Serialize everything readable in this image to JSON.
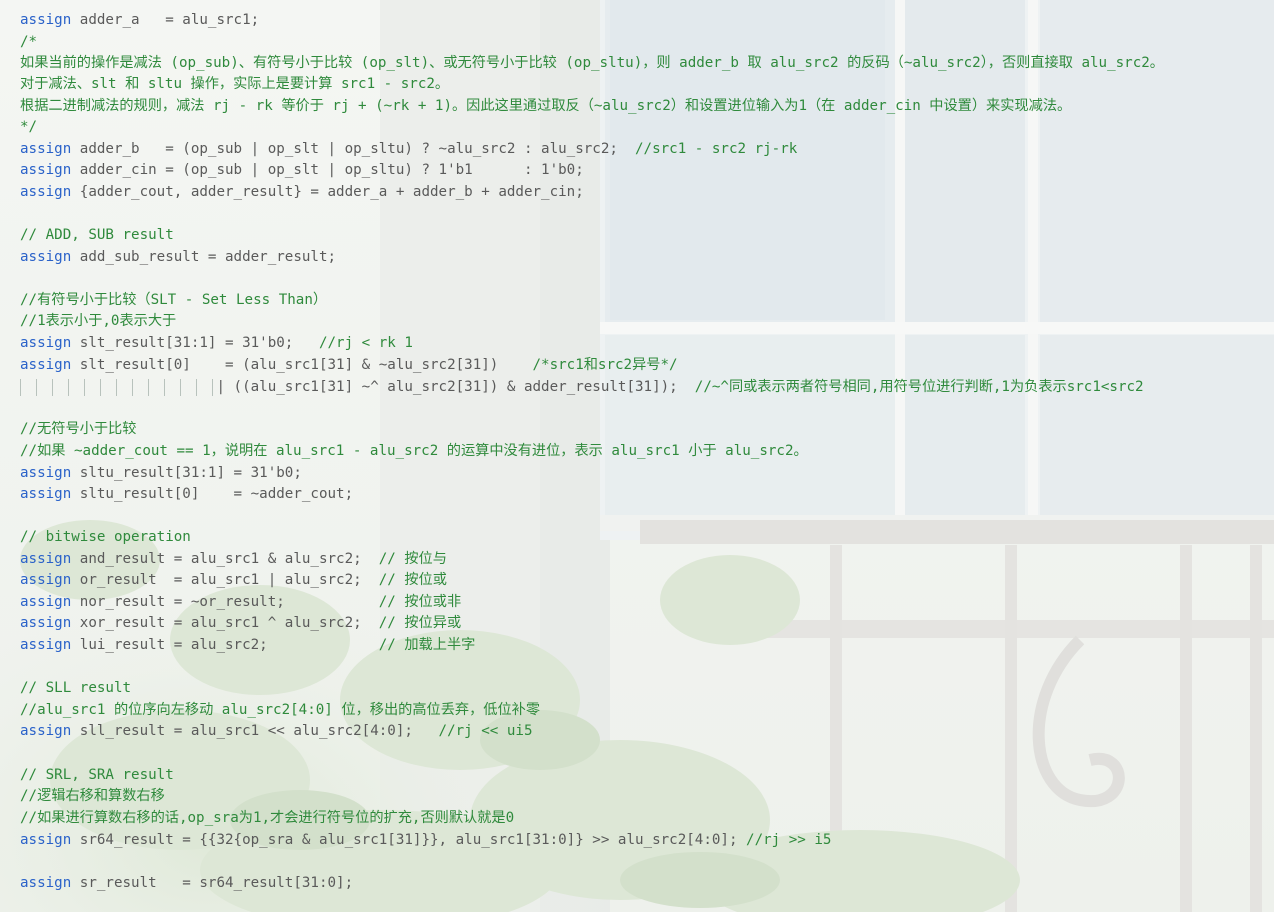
{
  "editor": {
    "lines": [
      {
        "kw": "assign",
        "rest": " adder_a   = alu_src1;"
      },
      {
        "cm": "/*"
      },
      {
        "cm": "如果当前的操作是减法 (op_sub)、有符号小于比较 (op_slt)、或无符号小于比较 (op_sltu)，则 adder_b 取 alu_src2 的反码（~alu_src2），否则直接取 alu_src2。"
      },
      {
        "cm": "对于减法、slt 和 sltu 操作，实际上是要计算 src1 - src2。"
      },
      {
        "cm": "根据二进制减法的规则，减法 rj - rk 等价于 rj + (~rk + 1)。因此这里通过取反（~alu_src2）和设置进位输入为1（在 adder_cin 中设置）来实现减法。"
      },
      {
        "cm": "*/"
      },
      {
        "kw": "assign",
        "rest": " adder_b   = (op_sub | op_slt | op_sltu) ? ~alu_src2 : alu_src2;  ",
        "cm": "//src1 - src2 rj-rk"
      },
      {
        "kw": "assign",
        "rest": " adder_cin = (op_sub | op_slt | op_sltu) ? 1'b1      : 1'b0;"
      },
      {
        "kw": "assign",
        "rest": " {adder_cout, adder_result} = adder_a + adder_b + adder_cin;"
      },
      {},
      {
        "cm": "// ADD, SUB result"
      },
      {
        "kw": "assign",
        "rest": " add_sub_result = adder_result;"
      },
      {},
      {
        "cm": "//有符号小于比较（SLT - Set Less Than）"
      },
      {
        "cm": "//1表示小于,0表示大于"
      },
      {
        "kw": "assign",
        "rest": " slt_result[31:1] = 31'b0;   ",
        "cm": "//rj < rk 1"
      },
      {
        "kw": "assign",
        "rest": " slt_result[0]    = (alu_src1[31] & ~alu_src2[31])    ",
        "cm": "/*src1和src2异号*/"
      },
      {
        "rest": "                       | ((alu_src1[31] ~^ alu_src2[31]) & adder_result[31]);  ",
        "cm": "//~^同或表示两者符号相同,用符号位进行判断,1为负表示src1<src2"
      },
      {},
      {
        "cm": "//无符号小于比较"
      },
      {
        "cm": "//如果 ~adder_cout == 1，说明在 alu_src1 - alu_src2 的运算中没有进位，表示 alu_src1 小于 alu_src2。"
      },
      {
        "kw": "assign",
        "rest": " sltu_result[31:1] = 31'b0;"
      },
      {
        "kw": "assign",
        "rest": " sltu_result[0]    = ~adder_cout;"
      },
      {},
      {
        "cm": "// bitwise operation"
      },
      {
        "kw": "assign",
        "rest": " and_result = alu_src1 & alu_src2;  ",
        "cm": "// 按位与"
      },
      {
        "kw": "assign",
        "rest": " or_result  = alu_src1 | alu_src2;  ",
        "cm": "// 按位或"
      },
      {
        "kw": "assign",
        "rest": " nor_result = ~or_result;           ",
        "cm": "// 按位或非"
      },
      {
        "kw": "assign",
        "rest": " xor_result = alu_src1 ^ alu_src2;  ",
        "cm": "// 按位异或"
      },
      {
        "kw": "assign",
        "rest": " lui_result = alu_src2;             ",
        "cm": "// 加载上半字"
      },
      {},
      {
        "cm": "// SLL result"
      },
      {
        "cm": "//alu_src1 的位序向左移动 alu_src2[4:0] 位，移出的高位丢弃，低位补零"
      },
      {
        "kw": "assign",
        "rest": " sll_result = alu_src1 << alu_src2[4:0];   ",
        "cm": "//rj << ui5"
      },
      {},
      {
        "cm": "// SRL, SRA result"
      },
      {
        "cm": "//逻辑右移和算数右移"
      },
      {
        "cm": "//如果进行算数右移的话,op_sra为1,才会进行符号位的扩充,否则默认就是0"
      },
      {
        "kw": "assign",
        "rest": " sr64_result = {{32{op_sra & alu_src1[31]}}, alu_src1[31:0]} >> alu_src2[4:0]; ",
        "cm": "//rj >> i5"
      },
      {},
      {
        "kw": "assign",
        "rest": " sr_result   = sr64_result[31:0];"
      }
    ]
  },
  "colors": {
    "keyword": "#2a62c9",
    "comment": "#2f8a3c",
    "text": "#5a5a5a"
  }
}
